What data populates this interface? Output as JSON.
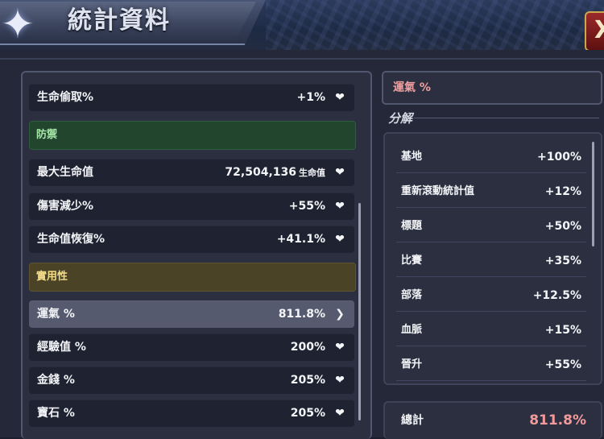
{
  "header": {
    "title": "統計資料",
    "close_glyph": "X",
    "emblem_icon": "star-emblem-icon"
  },
  "stats": {
    "rows": [
      {
        "label": "生命偷取%",
        "value": "+1%",
        "unit": ""
      },
      {
        "label": "最大生命值",
        "value": "72,504,136",
        "unit": "生命值"
      },
      {
        "label": "傷害減少%",
        "value": "+55%",
        "unit": ""
      },
      {
        "label": "生命值恢復%",
        "value": "+41.1%",
        "unit": ""
      },
      {
        "label": "運氣 %",
        "value": "811.8%",
        "unit": ""
      },
      {
        "label": "經驗值 %",
        "value": "200%",
        "unit": ""
      },
      {
        "label": "金錢 %",
        "value": "205%",
        "unit": ""
      },
      {
        "label": "寶石 %",
        "value": "205%",
        "unit": ""
      }
    ],
    "sections": {
      "defense": "防禦",
      "utility": "實用性"
    },
    "selected": "運氣 %"
  },
  "detail": {
    "title": "運氣 %",
    "breakdown_header": "分解",
    "items": [
      {
        "label": "基地",
        "value": "+100%"
      },
      {
        "label": "重新滾動統計值",
        "value": "+12%"
      },
      {
        "label": "標題",
        "value": "+50%"
      },
      {
        "label": "比賽",
        "value": "+35%"
      },
      {
        "label": "部落",
        "value": "+12.5%"
      },
      {
        "label": "血脈",
        "value": "+15%"
      },
      {
        "label": "晉升",
        "value": "+55%"
      }
    ],
    "total_label": "總計",
    "total_value": "811.8%"
  },
  "colors": {
    "accent_red": "#f29a9a",
    "defense_green": "#22452e",
    "utility_gold": "#4a4326"
  }
}
